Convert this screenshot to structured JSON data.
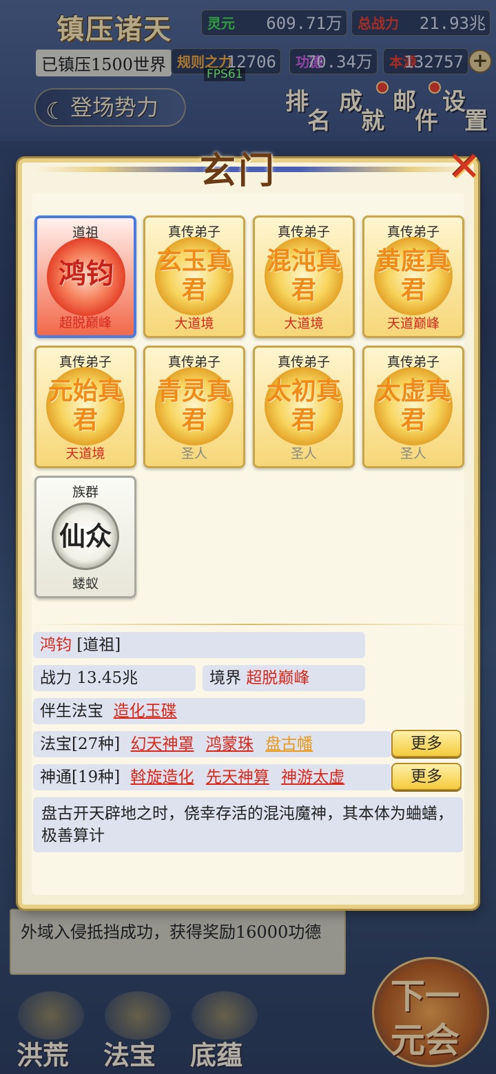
{
  "header": {
    "game_title": "镇压诸天",
    "suppressed": "已镇压1500世界",
    "fps": "FPS61",
    "stats": [
      {
        "label": "灵元",
        "value": "609.71万",
        "color": "#3ed34a"
      },
      {
        "label": "总战力",
        "value": "21.93兆",
        "color": "#e23a2a"
      },
      {
        "label": "规则之力",
        "value": "12706",
        "color": "#e8a03a"
      },
      {
        "label": "功德",
        "value": "70.34万",
        "color": "#c45ad8"
      },
      {
        "label": "本源",
        "value": "132757",
        "color": "#e23a2a"
      }
    ],
    "power_button": "登场势力",
    "nav": [
      {
        "c1": "排",
        "c2": "名"
      },
      {
        "c1": "成",
        "c2": "就"
      },
      {
        "c1": "邮",
        "c2": "件"
      },
      {
        "c1": "设",
        "c2": "置"
      }
    ]
  },
  "background": {
    "message": "外域入侵抵挡成功，获得奖励16000功德",
    "tabs": [
      "洪荒",
      "法宝",
      "底蕴"
    ],
    "next_era": [
      "下一",
      "元会"
    ]
  },
  "modal": {
    "title": "玄门",
    "close_icon": "close-x-icon",
    "cards": [
      {
        "role": "道祖",
        "name": "鸿钧",
        "realm": "超脱巅峰",
        "style": "red",
        "selected": true
      },
      {
        "role": "真传弟子",
        "name": "玄玉真君",
        "realm": "大道境",
        "style": "gold"
      },
      {
        "role": "真传弟子",
        "name": "混沌真君",
        "realm": "大道境",
        "style": "gold"
      },
      {
        "role": "真传弟子",
        "name": "黄庭真君",
        "realm": "天道巅峰",
        "style": "gold"
      },
      {
        "role": "真传弟子",
        "name": "元始真君",
        "realm": "天道境",
        "style": "gold"
      },
      {
        "role": "真传弟子",
        "name": "青灵真君",
        "realm": "圣人",
        "style": "gold"
      },
      {
        "role": "真传弟子",
        "name": "太初真君",
        "realm": "圣人",
        "style": "gold"
      },
      {
        "role": "真传弟子",
        "name": "太虚真君",
        "realm": "圣人",
        "style": "gold"
      },
      {
        "role": "族群",
        "name": "仙众",
        "realm": "蝼蚁",
        "style": "silver"
      }
    ],
    "detail": {
      "name": "鸿钧",
      "title": "[道祖]",
      "power_label": "战力",
      "power_value": "13.45兆",
      "realm_label": "境界",
      "realm_value": "超脱巅峰",
      "companion_label": "伴生法宝",
      "companion_value": "造化玉碟",
      "treasure_label": "法宝[27种]",
      "treasures": [
        "幻天神罩",
        "鸿蒙珠",
        "盘古幡"
      ],
      "skill_label": "神通[19种]",
      "skills": [
        "斡旋造化",
        "先天神算",
        "神游太虚"
      ],
      "more_label": "更多",
      "description": "盘古开天辟地之时，侥幸存活的混沌魔神，其本体为蛐蟮，极善算计"
    }
  }
}
